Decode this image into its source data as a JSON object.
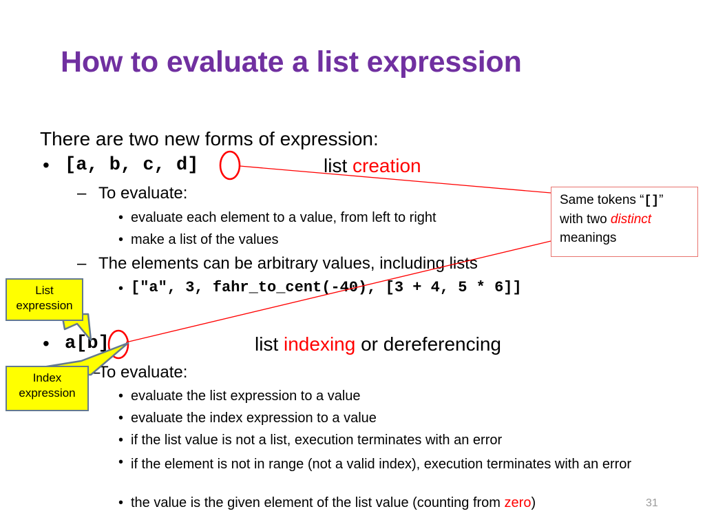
{
  "slide": {
    "title": "How to evaluate a list expression",
    "number": "31",
    "title_color": "#7030A0",
    "accent_red": "#FF0000",
    "callout_yellow": "#FFFF00",
    "callout_border": "#63798F",
    "red_box_border": "#E8736E"
  },
  "body": {
    "intro": "There are two new forms of expression:",
    "creation": {
      "code": "[a, b, c, d]",
      "label_plain": "list ",
      "label_accent": "creation",
      "sub_heading": "To evaluate:",
      "steps": [
        "evaluate each element to a value, from left to right",
        "make a list of the values"
      ],
      "note": "The elements can be arbitrary values, including lists",
      "example_code": "[\"a\", 3, fahr_to_cent(-40), [3 + 4, 5 * 6]]"
    },
    "indexing": {
      "code": "a[b]",
      "label_plain_before": "list ",
      "label_accent": "indexing",
      "label_plain_after": " or dereferencing",
      "sub_heading": "To evaluate:",
      "steps": [
        "evaluate the list expression to a value",
        "evaluate the index expression to a value",
        "if the list value is not a list, execution terminates with an error",
        "if the element is not in range (not a valid index), execution terminates with an error"
      ],
      "last_step_prefix": "the value is the given element of the list value (counting from ",
      "last_step_accent": "zero",
      "last_step_suffix": ")"
    }
  },
  "callouts": {
    "red_note": {
      "line1_prefix": "Same tokens “",
      "line1_tokens": "[]",
      "line1_suffix": "”",
      "line2_prefix": "with two ",
      "line2_accent": "distinct",
      "line3": "meanings"
    },
    "list_expression": {
      "line1": "List",
      "line2": "expression"
    },
    "index_expression": {
      "line1": "Index",
      "line2": "expression"
    }
  }
}
